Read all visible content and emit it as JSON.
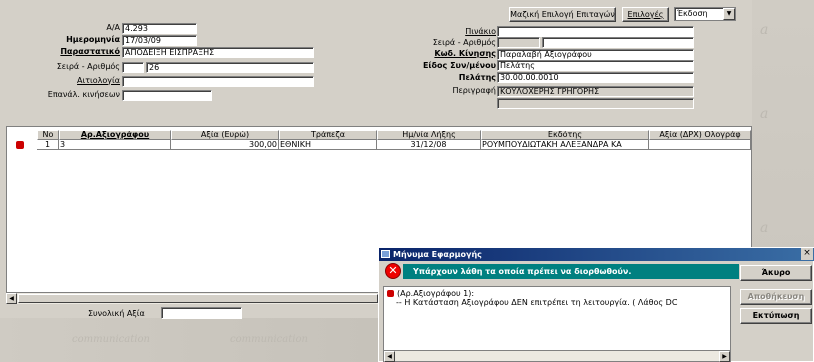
{
  "header": {
    "bulk_button": "Μαζική Επιλογή Επιταγών",
    "options_button": "Επιλογές",
    "issue_select": "Έκδοση"
  },
  "form": {
    "aa_label": "Α/Α",
    "aa_value": "4.293",
    "date_label": "Ημερομηνία",
    "date_value": "17/03/09",
    "receipt_label": "Παραστατικό",
    "receipt_value": "ΑΠΟΔΕΙΞΗ ΕΙΣΠΡΑΞΗΣ",
    "series_label": "Σειρά - Αριθμός",
    "series_value": "",
    "number_value": "26",
    "reason_label": "Αιτιολογία",
    "reason_value": "",
    "repeat_label": "Επανάλ. κινήσεων",
    "repeat_value": "",
    "pinakio_label": "Πινάκιο",
    "pinakio_value": "",
    "series2_label": "Σειρά - Αριθμός",
    "series2_value": "",
    "number2_value": "",
    "movement_code_label": "Κωδ. Κίνησης",
    "movement_code_value": "Παραλαβή Αξιογράφου",
    "party_type_label": "Είδος Συν/μένου",
    "party_type_value": "Πελάτης",
    "customer_label": "Πελάτης",
    "customer_value": "30.00.00.0010",
    "description_label": "Περιγραφή",
    "description_value": "ΚΟΥΛΟΧΕΡΗΣ ΓΡΗΓΟΡΗΣ",
    "description_value2": ""
  },
  "grid": {
    "columns": [
      "Νο",
      "Αρ.Αξιογράφου",
      "Αξία (Ευρώ)",
      "Τράπεζα",
      "Ημ/νία Λήξης",
      "Εκδότης",
      "Αξία (ΔΡΧ) Ολογράφ"
    ],
    "rows": [
      {
        "no": "1",
        "check_no": "3",
        "value": "300,00",
        "bank": "ΕΘΝΙΚΗ",
        "due_date": "31/12/08",
        "issuer": "ΡΟΥΜΠΟΥΔΙΩΤΑΚΗ ΑΛΕΞΑΝΔΡΑ ΚΑ",
        "drx": ""
      }
    ]
  },
  "total": {
    "label": "Συνολική Αξία",
    "value": ""
  },
  "dialog": {
    "title": "Μήνυμα Εφαρμογής",
    "error_header": "Υπάρχουν λάθη τα οποία πρέπει να διορθωθούν.",
    "line1": "(Αρ.Αξιογράφου 1):",
    "line2": "-- Η Κατάσταση Αξιογράφου ΔΕΝ επιτρέπει τη λειτουργία. ( Λάθος DC",
    "cancel_button": "Άκυρο",
    "save_button": "Αποθήκευση",
    "print_button": "Εκτύπωση",
    "close": "×"
  },
  "watermark": {
    "word": "communication"
  }
}
